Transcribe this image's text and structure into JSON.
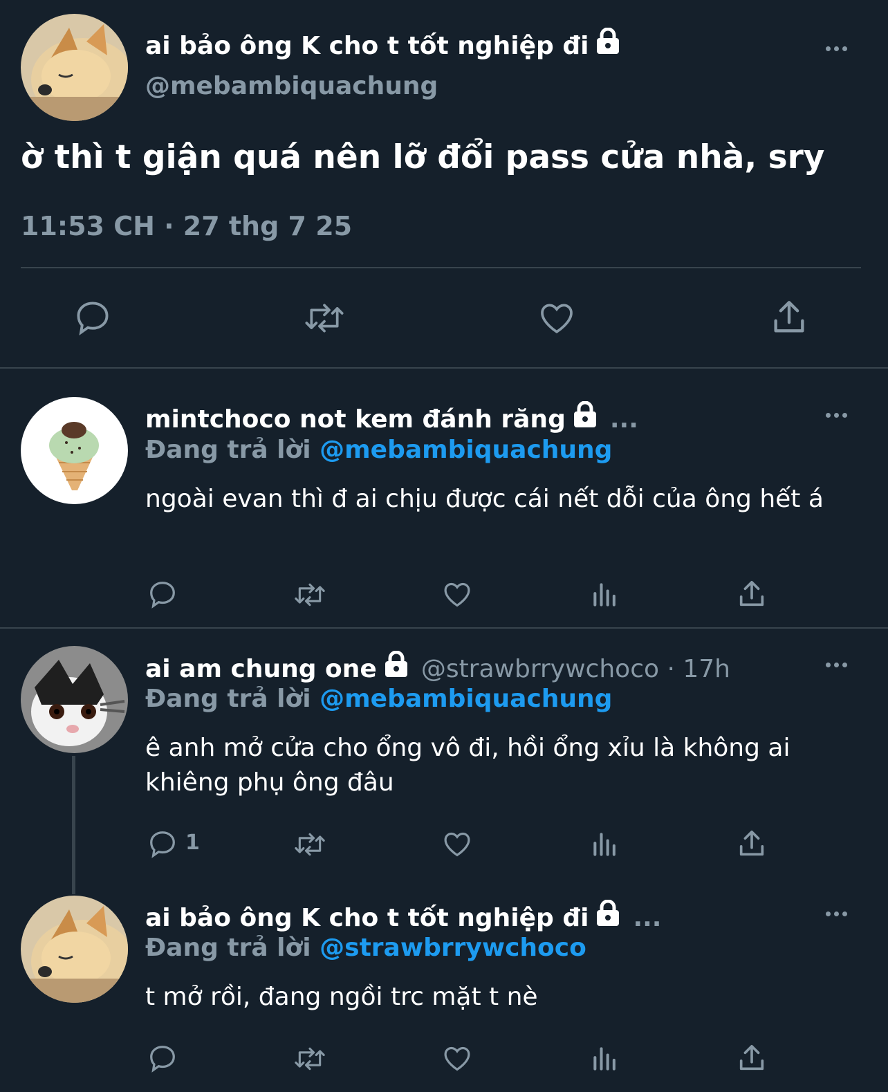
{
  "main_tweet": {
    "display_name": "ai bảo ông K cho t tốt nghiệp đi",
    "handle": "@mebambiquachung",
    "text": "ờ thì t giận quá nên lỡ đổi pass cửa nhà, sry",
    "timestamp": "11:53 CH · 27 thg 7 25"
  },
  "replies": [
    {
      "display_name": "mintchoco not kem đánh răng",
      "ellipsis": "...",
      "replying_label": "Đang trả lời",
      "replying_to": "@mebambiquachung",
      "text": "ngoài evan thì đ ai chịu được cái nết dỗi của ông hết á"
    },
    {
      "display_name": "ai am chung one",
      "handle_time": "@strawbrrywchoco · 17h",
      "replying_label": "Đang trả lời",
      "replying_to": "@mebambiquachung",
      "text": "ê anh mở cửa cho ổng vô đi, hồi ổng xỉu là không ai khiêng phụ ông đâu",
      "reply_count": "1"
    },
    {
      "display_name": "ai bảo ông K cho t tốt nghiệp đi",
      "ellipsis": "...",
      "replying_label": "Đang trả lời",
      "replying_to": "@strawbrrywchoco",
      "text": "t mở rồi, đang ngồi trc mặt t nè"
    }
  ],
  "colors": {
    "background": "#15202b",
    "secondary_text": "#8899a6",
    "link": "#1d9bf0",
    "divider": "#38444d"
  }
}
